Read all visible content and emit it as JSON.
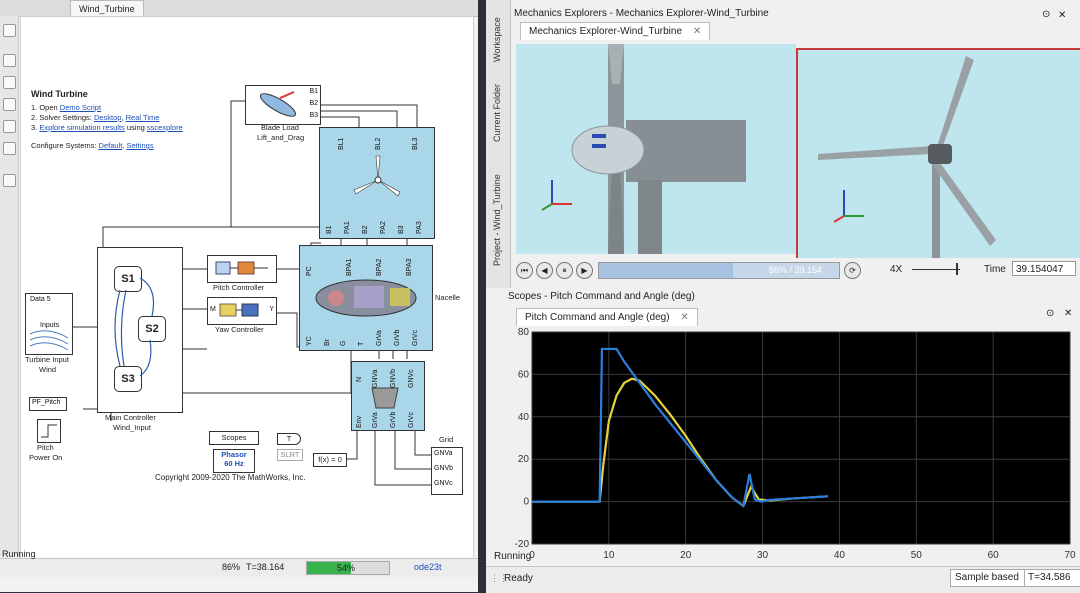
{
  "simulink": {
    "tab_title": "Wind_Turbine",
    "model_title": "Wind Turbine",
    "instructions": {
      "line1_prefix": "1. Open ",
      "line1_link": "Demo Script",
      "line2_prefix": "2. Solver Settings: ",
      "line2_link1": "Desktop",
      "line2_sep": ", ",
      "line2_link2": "Real Time",
      "line3_prefix": "3. ",
      "line3_link1": "Explore simulation results",
      "line3_mid": " using ",
      "line3_link2": "sscexplore",
      "configure_prefix": "Configure Systems: ",
      "configure_link1": "Default",
      "configure_sep": ", ",
      "configure_link2": "Settings"
    },
    "blocks": {
      "blade_load_name": "Blade Load",
      "blade_load_sub": "Lift_and_Drag",
      "rotor_ports_top": [
        "BL1",
        "BL2",
        "BL3"
      ],
      "rotor_ports_bottom": [
        "B1",
        "PA1",
        "B2",
        "PA2",
        "B3",
        "PA3"
      ],
      "blade_ports": [
        "B1",
        "B2",
        "B3"
      ],
      "nacelle_name": "Nacelle",
      "nacelle_ports_top": [
        "PC",
        "BPA1",
        "BPA2",
        "BPA3"
      ],
      "nacelle_ports_bottom": [
        "YC",
        "Br",
        "G",
        "T",
        "GrVa",
        "GrVb",
        "GrVc"
      ],
      "generator_ports_top": [
        "N",
        "GNVa",
        "GNVb",
        "GNVc"
      ],
      "generator_ports_bottom": [
        "Env",
        "GrVa",
        "GrVb",
        "GrVc"
      ],
      "grid_name": "Grid",
      "grid_ports": [
        "GNVa",
        "GNVb",
        "GNVc"
      ],
      "pitch_controller": "Pitch Controller",
      "yaw_controller": "Yaw Controller",
      "yaw_ports": [
        "M",
        "Y"
      ],
      "main_controller": "Main Controller",
      "main_controller_sub": "Wind_Input",
      "states": [
        "S1",
        "S2",
        "S3"
      ],
      "data_label": "Data 5",
      "inputs_label": "Inputs",
      "turbine_input": "Turbine Input",
      "turbine_input_sub": "Wind",
      "pf_pitch": "PF_Pitch",
      "pitch_power_on": "Pitch",
      "pitch_power_on2": "Power On",
      "scopes_label": "Scopes",
      "goto_t": "T",
      "goto_slrt": "SLRT",
      "phasor": "Phasor",
      "phasor_hz": "60 Hz",
      "fx_block": "f(x) = 0",
      "copyright": "Copyright 2009-2020 The MathWorks, Inc."
    },
    "status": {
      "running": "Running",
      "zoom": "86%",
      "time": "T=38.164",
      "progress_text": "54%",
      "progress_fraction": 0.54,
      "solver": "ode23t"
    }
  },
  "mechanics": {
    "window_title": "Mechanics Explorers - Mechanics Explorer-Wind_Turbine",
    "tab": "Mechanics Explorer-Wind_Turbine",
    "side_tabs": [
      "Workspace",
      "Current Folder",
      "Project - Wind_Turbine"
    ],
    "playback_text": "56% / 39.154",
    "playback_fraction": 0.56,
    "speed": "4X",
    "time_label": "Time",
    "time_value": "39.154047"
  },
  "scope": {
    "window_title": "Scopes - Pitch Command and Angle (deg)",
    "tab": "Pitch Command and Angle (deg)",
    "status_left": "Running",
    "ready": "Ready",
    "sample_based": "Sample based",
    "time": "T=34.586"
  },
  "chart_data": {
    "type": "line",
    "title": "",
    "xlabel": "",
    "ylabel": "",
    "xlim": [
      0,
      70
    ],
    "ylim": [
      -20,
      80
    ],
    "xticks": [
      0,
      10,
      20,
      30,
      40,
      50,
      60,
      70
    ],
    "yticks": [
      -20,
      0,
      20,
      40,
      60,
      80
    ],
    "grid": true,
    "series": [
      {
        "color": "#2a7fdc",
        "x": [
          0,
          8.8,
          9.1,
          11,
          12,
          14,
          16,
          18,
          20,
          22,
          24,
          26,
          27.5,
          28.3,
          29,
          29.8,
          31,
          34,
          38.5
        ],
        "y": [
          0,
          0,
          72,
          72,
          66,
          56,
          46,
          37,
          28,
          19,
          10,
          2,
          -2,
          13,
          1,
          0,
          0.8,
          1.5,
          2.5
        ]
      },
      {
        "color": "#e3d43c",
        "x": [
          0,
          8.8,
          9.3,
          10,
          11,
          12,
          13,
          14,
          16,
          18,
          20,
          22,
          24,
          26,
          27.5,
          28.5,
          29.5,
          31,
          34,
          38.5
        ],
        "y": [
          0,
          0,
          18,
          38,
          50,
          56,
          58,
          57,
          50,
          41,
          31,
          20,
          10,
          2,
          -2,
          7,
          1,
          0.5,
          1.5,
          2.5
        ]
      }
    ]
  }
}
